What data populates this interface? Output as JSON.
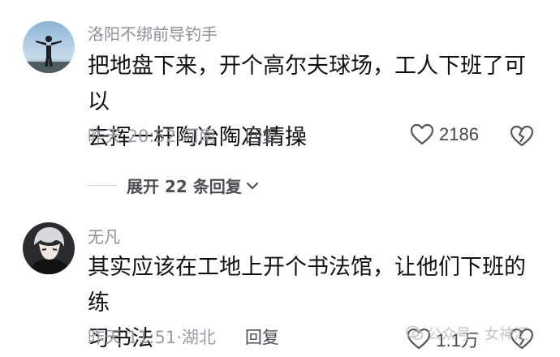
{
  "comments": [
    {
      "username": "洛阳不绑前导钓手",
      "text_line1": "把地盘下来，开个高尔夫球场，工人下班了可以",
      "text_line2": "去挥一杆陶冶陶冶情操",
      "time": "昨天 20:52",
      "location": "河南",
      "reply_label": "回复",
      "likes": "2186",
      "avatar": "avatar-standing-figure"
    },
    {
      "username": "无凡",
      "text_line1": "其实应该在工地上开个书法馆，让他们下班的练",
      "text_line2": "习书法",
      "time": "昨天 11:51",
      "location": "湖北",
      "reply_label": "回复",
      "likes": "1.1万",
      "avatar": "avatar-anime-character"
    }
  ],
  "expand_replies": "展开 22 条回复",
  "watermark": "公众号 · 女神汇",
  "colors": {
    "text_primary": "#111111",
    "text_secondary": "#9a9ca3",
    "reply": "#4a4c52"
  }
}
